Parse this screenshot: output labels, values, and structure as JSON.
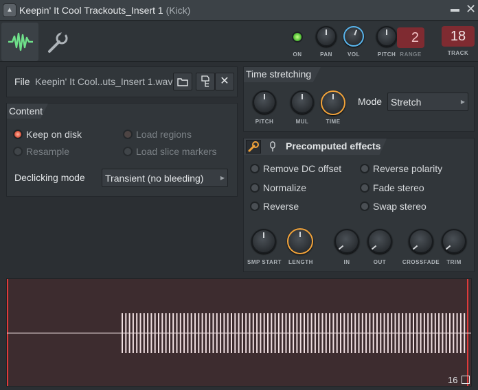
{
  "window": {
    "title": "Keepin' It Cool Trackouts_Insert 1",
    "title_suffix": "(Kick)",
    "menu_glyph": "▬",
    "close_glyph": "✕",
    "sys_glyph": "▲"
  },
  "toolbar": {
    "on_label": "ON",
    "pan_label": "PAN",
    "vol_label": "VOL",
    "pitch_label": "PITCH",
    "range_label": "RANGE",
    "range_value": "2",
    "track_label": "TRACK",
    "track_value": "18"
  },
  "file": {
    "label": "File",
    "name": "Keepin' It Cool..uts_Insert 1.wav"
  },
  "content": {
    "header": "Content",
    "keep_on_disk": "Keep on disk",
    "resample": "Resample",
    "load_regions": "Load regions",
    "load_slice_markers": "Load slice markers",
    "declicking_label": "Declicking mode",
    "declicking_value": "Transient (no bleeding)"
  },
  "time_stretching": {
    "header": "Time stretching",
    "pitch_label": "PITCH",
    "mul_label": "MUL",
    "time_label": "TIME",
    "mode_label": "Mode",
    "mode_value": "Stretch"
  },
  "precomputed": {
    "header": "Precomputed effects",
    "remove_dc": "Remove DC offset",
    "normalize": "Normalize",
    "reverse": "Reverse",
    "reverse_polarity": "Reverse polarity",
    "fade_stereo": "Fade stereo",
    "swap_stereo": "Swap stereo",
    "knobs": [
      "SMP START",
      "LENGTH",
      "IN",
      "OUT",
      "CROSSFADE",
      "TRIM"
    ]
  },
  "waveform": {
    "counter": "16"
  },
  "colors": {
    "accent_orange": "#f2a33a",
    "accent_blue": "#58b4ec",
    "led_green": "#56c23a",
    "display_red": "#7f2b31"
  }
}
